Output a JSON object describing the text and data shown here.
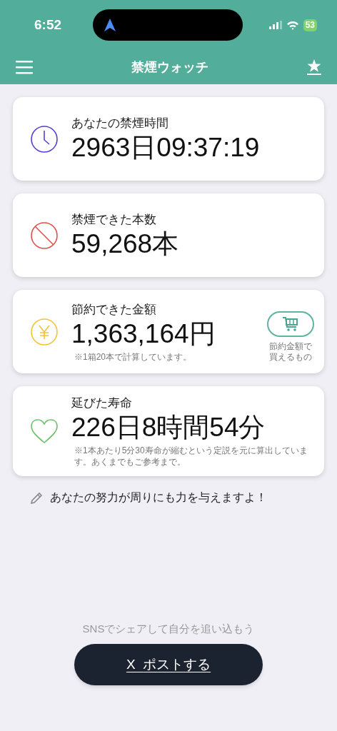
{
  "status_bar": {
    "time": "6:52",
    "battery": "53"
  },
  "header": {
    "title": "禁煙ウォッチ"
  },
  "cards": [
    {
      "kind": "clock",
      "color": "#5b3fd0",
      "label": "あなたの禁煙時間",
      "value": "2963日09:37:19"
    },
    {
      "kind": "prohibit",
      "color": "#e0504a",
      "label": "禁煙できた本数",
      "value": "59,268本"
    },
    {
      "kind": "yen",
      "color": "#f2c23a",
      "label": "節約できた金額",
      "value": "1,363,164円",
      "note": "※1箱20本で計算しています。",
      "action": "節約金額で買えるもの"
    },
    {
      "kind": "heart",
      "color": "#6cc06a",
      "label": "延びた寿命",
      "value": "226日8時間54分",
      "note": "※1本あたり5分30寿命が縮むという定説を元に算出しています。あくまでもご参考まで。"
    }
  ],
  "message": "あなたの努力が周りにも力を与えますよ！",
  "share": {
    "hint": "SNSでシェアして自分を追い込もう",
    "button": "X  ポストする"
  }
}
